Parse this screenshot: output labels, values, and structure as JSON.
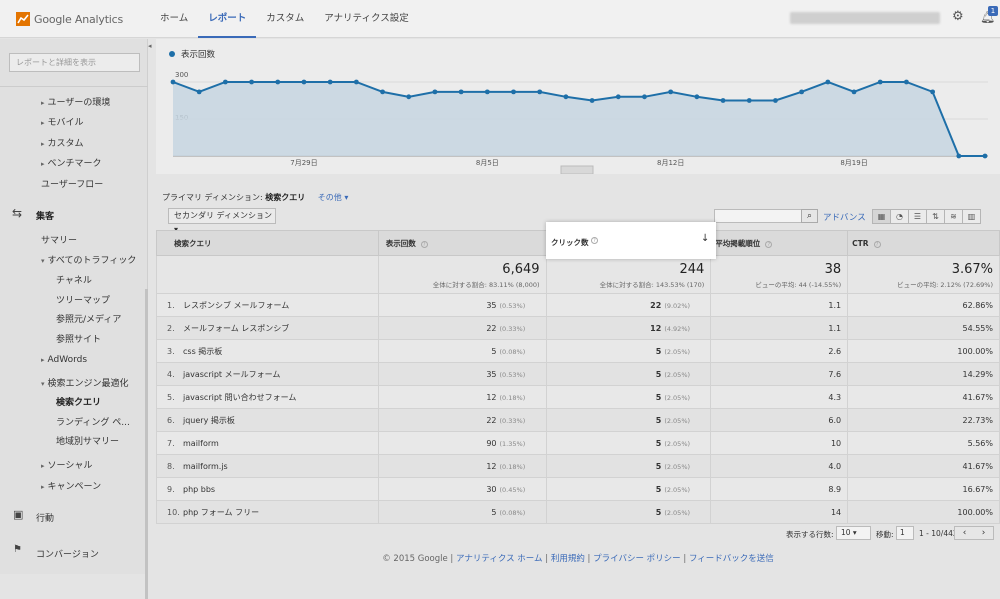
{
  "app": {
    "logo_text": "Google Analytics"
  },
  "nav": {
    "items": [
      "ホーム",
      "レポート",
      "カスタム",
      "アナリティクス設定"
    ]
  },
  "sidebar": {
    "search_placeholder": "レポートと詳細を表示",
    "items": [
      {
        "label": "ユーザーの環境"
      },
      {
        "label": "モバイル"
      },
      {
        "label": "カスタム"
      },
      {
        "label": "ベンチマーク"
      },
      {
        "label": "ユーザーフロー"
      },
      {
        "label": "集客"
      },
      {
        "label": "サマリー"
      },
      {
        "label": "すべてのトラフィック"
      },
      {
        "label": "チャネル"
      },
      {
        "label": "ツリーマップ"
      },
      {
        "label": "参照元/メディア"
      },
      {
        "label": "参照サイト"
      },
      {
        "label": "AdWords"
      },
      {
        "label": "検索エンジン最適化"
      },
      {
        "label": "検索クエリ"
      },
      {
        "label": "ランディング ペ..."
      },
      {
        "label": "地域別サマリー"
      },
      {
        "label": "ソーシャル"
      },
      {
        "label": "キャンペーン"
      },
      {
        "label": "行動"
      },
      {
        "label": "コンバージョン"
      }
    ]
  },
  "chart": {
    "legend": "表示回数",
    "y_ticks": [
      "300",
      "150"
    ],
    "x_ticks": [
      "7月29日",
      "8月5日",
      "8月12日",
      "8月19日"
    ]
  },
  "chart_data": {
    "type": "area",
    "series": [
      {
        "name": "表示回数",
        "values": [
          300,
          260,
          300,
          300,
          300,
          300,
          300,
          300,
          260,
          240,
          260,
          260,
          260,
          260,
          260,
          240,
          225,
          240,
          240,
          260,
          240,
          225,
          225,
          225,
          260,
          300,
          260,
          300,
          300,
          260,
          0,
          0
        ]
      }
    ],
    "ylim": [
      0,
      300
    ],
    "x_ticks": [
      "7月29日",
      "8月5日",
      "8月12日",
      "8月19日"
    ],
    "color": "#1e6fa8"
  },
  "controls": {
    "primary_label": "プライマリ ディメンション:",
    "primary_value": "検索クエリ",
    "other": "その他 ▾",
    "secondary_dim": "セカンダリ ディメンション ▾",
    "advance": "アドバンス"
  },
  "table": {
    "headers": [
      "検索クエリ",
      "表示回数",
      "クリック数",
      "平均掲載順位",
      "CTR"
    ],
    "totals": [
      {
        "big": "6,649",
        "sub": "全体に対する割合: 83.11% (8,000)"
      },
      {
        "big": "244",
        "sub": "全体に対する割合: 143.53% (170)"
      },
      {
        "big": "38",
        "sub": "ビューの平均: 44 (-14.55%)"
      },
      {
        "big": "3.67%",
        "sub": "ビューの平均: 2.12% (72.69%)"
      }
    ],
    "rows": [
      {
        "n": "1.",
        "q": "レスポンシブ メールフォーム",
        "imp": "35",
        "imp_pct": "(0.53%)",
        "clk": "22",
        "clk_pct": "(9.02%)",
        "pos": "1.1",
        "ctr": "62.86%"
      },
      {
        "n": "2.",
        "q": "メールフォーム レスポンシブ",
        "imp": "22",
        "imp_pct": "(0.33%)",
        "clk": "12",
        "clk_pct": "(4.92%)",
        "pos": "1.1",
        "ctr": "54.55%"
      },
      {
        "n": "3.",
        "q": "css 掲示板",
        "imp": "5",
        "imp_pct": "(0.08%)",
        "clk": "5",
        "clk_pct": "(2.05%)",
        "pos": "2.6",
        "ctr": "100.00%"
      },
      {
        "n": "4.",
        "q": "javascript メールフォーム",
        "imp": "35",
        "imp_pct": "(0.53%)",
        "clk": "5",
        "clk_pct": "(2.05%)",
        "pos": "7.6",
        "ctr": "14.29%"
      },
      {
        "n": "5.",
        "q": "javascript 問い合わせフォーム",
        "imp": "12",
        "imp_pct": "(0.18%)",
        "clk": "5",
        "clk_pct": "(2.05%)",
        "pos": "4.3",
        "ctr": "41.67%"
      },
      {
        "n": "6.",
        "q": "jquery 掲示板",
        "imp": "22",
        "imp_pct": "(0.33%)",
        "clk": "5",
        "clk_pct": "(2.05%)",
        "pos": "6.0",
        "ctr": "22.73%"
      },
      {
        "n": "7.",
        "q": "mailform",
        "imp": "90",
        "imp_pct": "(1.35%)",
        "clk": "5",
        "clk_pct": "(2.05%)",
        "pos": "10",
        "ctr": "5.56%"
      },
      {
        "n": "8.",
        "q": "mailform.js",
        "imp": "12",
        "imp_pct": "(0.18%)",
        "clk": "5",
        "clk_pct": "(2.05%)",
        "pos": "4.0",
        "ctr": "41.67%"
      },
      {
        "n": "9.",
        "q": "php bbs",
        "imp": "30",
        "imp_pct": "(0.45%)",
        "clk": "5",
        "clk_pct": "(2.05%)",
        "pos": "8.9",
        "ctr": "16.67%"
      },
      {
        "n": "10.",
        "q": "php フォーム フリー",
        "imp": "5",
        "imp_pct": "(0.08%)",
        "clk": "5",
        "clk_pct": "(2.05%)",
        "pos": "14",
        "ctr": "100.00%"
      }
    ]
  },
  "pager": {
    "rows_label": "表示する行数:",
    "rows_value": "10 ▾",
    "go_label": "移動:",
    "go_value": "1",
    "range": "1 - 10/442"
  },
  "footer": {
    "copyright": "© 2015 Google",
    "links": [
      "アナリティクス ホーム",
      "利用規約",
      "プライバシー ポリシー",
      "フィードバックを送信"
    ]
  }
}
